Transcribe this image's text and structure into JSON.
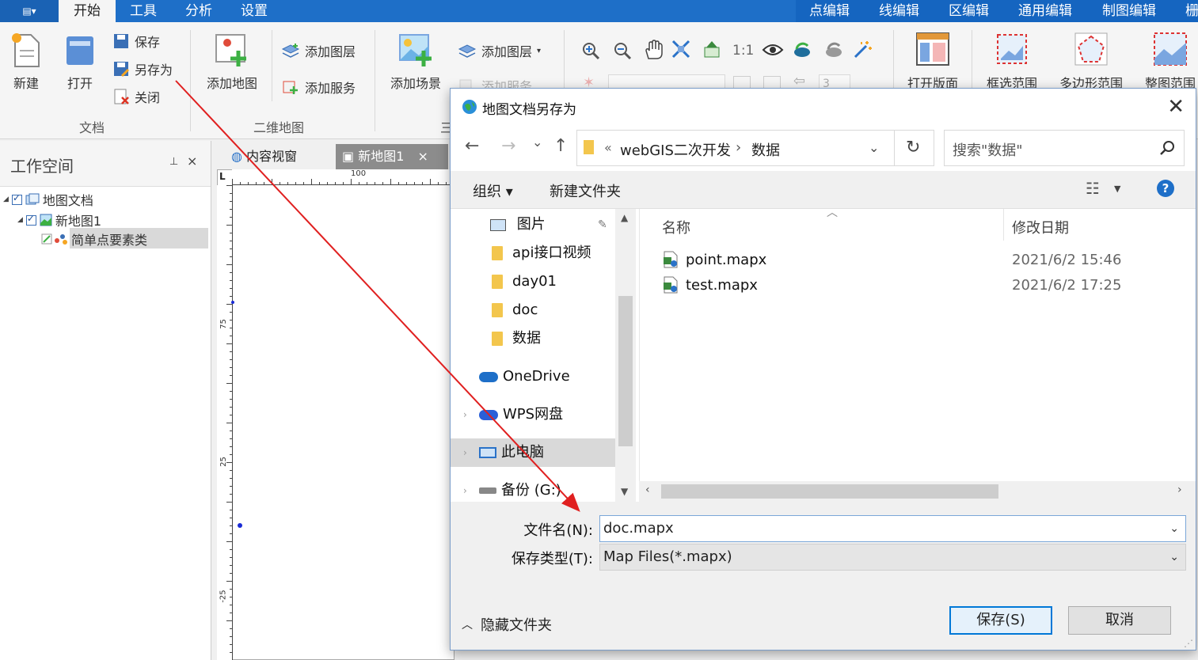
{
  "menubar": {
    "app_icon": "▤▾",
    "tabs": [
      "开始",
      "工具",
      "分析",
      "设置"
    ],
    "right_tabs": [
      "点编辑",
      "线编辑",
      "区编辑",
      "通用编辑",
      "制图编辑",
      "栅"
    ]
  },
  "ribbon": {
    "doc_group": {
      "new": "新建",
      "open": "打开",
      "save": "保存",
      "save_as": "另存为",
      "close": "关闭",
      "label": "文档"
    },
    "map2d_group": {
      "add_map": "添加地图",
      "add_layer": "添加图层",
      "add_service": "添加服务",
      "label": "二维地图"
    },
    "scene_group": {
      "add_scene": "添加场景",
      "add_layer": "添加图层",
      "add_service": "添加服务",
      "label_partial": "三"
    },
    "view_tools": {
      "scale_1_1": "1:1",
      "page_value": "3"
    },
    "layout_group": {
      "open_layout": "打开版面",
      "frame_range": "框选范围",
      "polygon_range": "多边形范围",
      "whole_range": "整图范围"
    }
  },
  "workspace": {
    "title": "工作空间",
    "pin": "⊥",
    "close": "×",
    "tree": {
      "root": "地图文档",
      "map": "新地图1",
      "layer": "简单点要素类"
    }
  },
  "map_area": {
    "tabs": {
      "content": "内容视窗",
      "map": "新地图1",
      "close": "×"
    },
    "ruler": {
      "top_label": "100",
      "left_labels": [
        "75",
        "25",
        "-25"
      ],
      "corner": "L"
    }
  },
  "dialog": {
    "title": "地图文档另存为",
    "close": "✕",
    "nav": {
      "back": "←",
      "forward": "→",
      "dropdown": "⌄",
      "up": "↑"
    },
    "breadcrumb": {
      "prefix": "«",
      "parent": "webGIS二次开发",
      "sep": "›",
      "current": "数据"
    },
    "search_placeholder": "搜索\"数据\"",
    "commands": {
      "organize": "组织 ▾",
      "new_folder": "新建文件夹"
    },
    "help": "?",
    "nav_items": [
      {
        "label": "图片",
        "kind": "pictures"
      },
      {
        "label": "api接口视频",
        "kind": "folder"
      },
      {
        "label": "day01",
        "kind": "folder"
      },
      {
        "label": "doc",
        "kind": "folder"
      },
      {
        "label": "数据",
        "kind": "folder"
      },
      {
        "label": "OneDrive",
        "kind": "cloud"
      },
      {
        "label": "WPS网盘",
        "kind": "cloud"
      },
      {
        "label": "此电脑",
        "kind": "pc"
      },
      {
        "label": "备份 (G:)",
        "kind": "drive"
      }
    ],
    "columns": {
      "name": "名称",
      "date": "修改日期"
    },
    "files": [
      {
        "name": "point.mapx",
        "date": "2021/6/2 15:46"
      },
      {
        "name": "test.mapx",
        "date": "2021/6/2 17:25"
      }
    ],
    "filename_label": "文件名(N):",
    "filename_value": "doc.mapx",
    "filetype_label": "保存类型(T):",
    "filetype_value": "Map Files(*.mapx)",
    "hide_folders": "隐藏文件夹",
    "save_button": "保存(S)",
    "cancel_button": "取消"
  },
  "colors": {
    "menubar": "#1e6fc8",
    "accent": "#0078d7",
    "arrow": "#e02020"
  }
}
